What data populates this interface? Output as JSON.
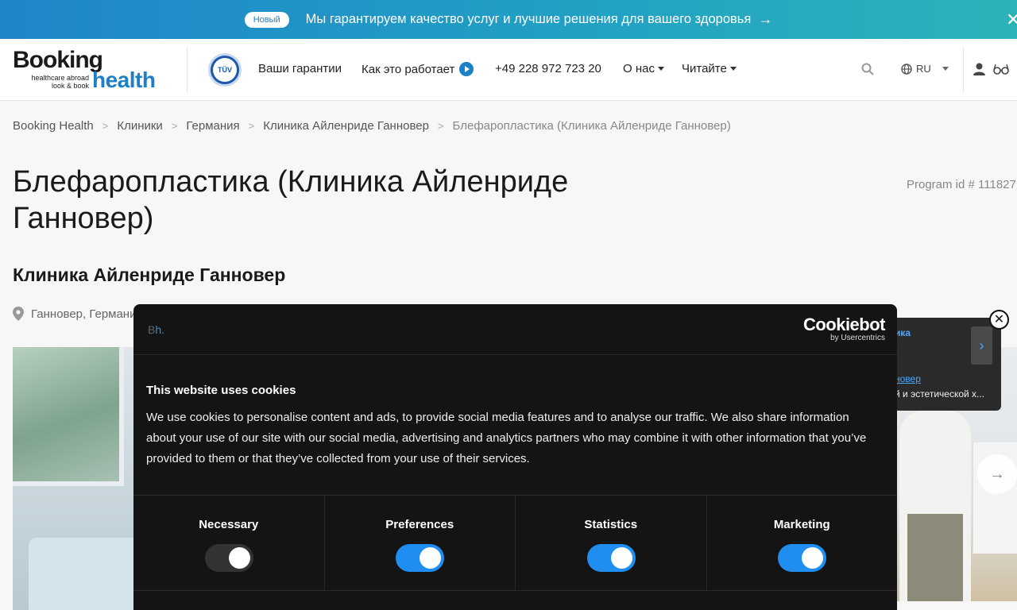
{
  "banner": {
    "badge": "Новый",
    "text": "Мы гарантируем качество услуг и лучшие решения для вашего здоровья",
    "arrow": "→",
    "close": "✕"
  },
  "header": {
    "logo_word1": "Booking",
    "logo_word2": "health",
    "logo_tagline_1": "healthcare abroad",
    "logo_tagline_2": "look & book",
    "tuv_text": "TÜV",
    "nav_guarantees": "Ваши гарантии",
    "nav_how": "Как это работает",
    "nav_phone": "+49 228 972 723 20",
    "nav_about": "О нас",
    "nav_read": "Читайте",
    "lang": "RU",
    "icons": [
      "search-icon",
      "globe-icon",
      "user-icon",
      "glasses-icon",
      "play-icon"
    ]
  },
  "breadcrumb": {
    "items": [
      "Booking Health",
      "Клиники",
      "Германия",
      "Клиника Айленриде Ганновер"
    ],
    "current": "Блефаропластика (Клиника Айленриде Ганновер)"
  },
  "page": {
    "title": "Блефаропластика (Клиника Айленриде Ганновер)",
    "program_id": "Program id # 111827",
    "clinic_name": "Клиника Айленриде Ганновер",
    "location": "Ганновер, Германия"
  },
  "popup": {
    "label": "ика",
    "link": "новер",
    "desc": "й и эстетической х...",
    "close": "✕"
  },
  "cookie": {
    "brand_prefix": "B",
    "brand_suffix": "h.",
    "cookiebot_name": "Cookiebot",
    "cookiebot_by": "by Usercentrics",
    "title": "This website uses cookies",
    "body": "We use cookies to personalise content and ads, to provide social media features and to analyse our traffic. We also share information about your use of our site with our social media, advertising and analytics partners who may combine it with other information that you’ve provided to them or that they’ve collected from your use of their services.",
    "categories": [
      {
        "label": "Necessary",
        "enabled": true,
        "locked": true
      },
      {
        "label": "Preferences",
        "enabled": true,
        "locked": false
      },
      {
        "label": "Statistics",
        "enabled": true,
        "locked": false
      },
      {
        "label": "Marketing",
        "enabled": true,
        "locked": false
      }
    ]
  },
  "colors": {
    "brand_blue": "#1d7fc4",
    "toggle_on": "#1f8ef0",
    "dialog_bg": "#141414"
  }
}
